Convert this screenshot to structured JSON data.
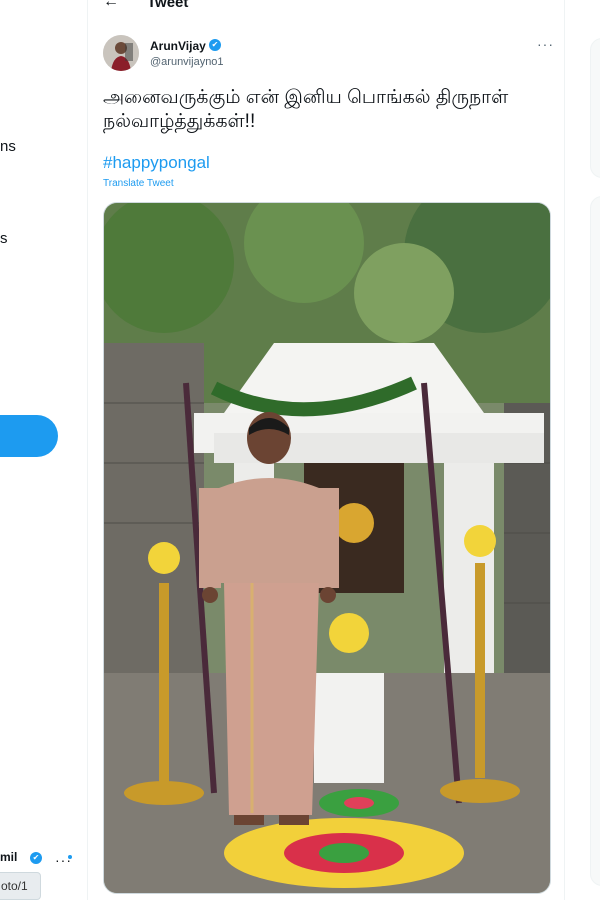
{
  "left_nav": {
    "frag1": "ns",
    "frag2": "s",
    "account_name": "mil",
    "link_preview": "oto/1"
  },
  "header": {
    "back_icon": "arrow-left-icon",
    "title": "Tweet"
  },
  "tweet": {
    "author": {
      "name": "ArunVijay",
      "handle": "@arunvijayno1",
      "verified": true
    },
    "text": "அனைவருக்கும் என் இனிய பொங்கல் திருநாள் நல்வாழ்த்துக்கள்!!",
    "hashtag": "#happypongal",
    "translate_label": "Translate Tweet",
    "more_icon": "more-horizontal-icon"
  },
  "colors": {
    "accent": "#1d9bf0",
    "text": "#0f1419",
    "secondary": "#536471"
  }
}
